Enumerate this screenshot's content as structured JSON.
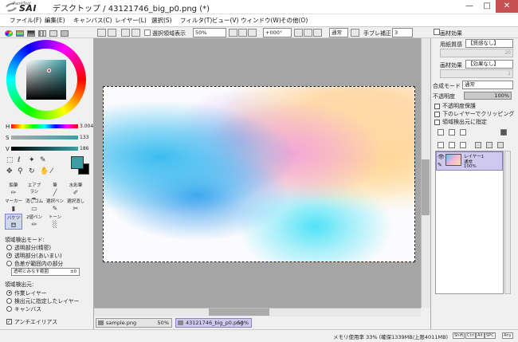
{
  "titlebar": {
    "logo_small": "PaintTool",
    "logo_big": "SAI",
    "window_title": "デスクトップ / 43121746_big_p0.png (*)",
    "min": "—",
    "max": "□",
    "close": "✕"
  },
  "menu": [
    "ファイル(F)",
    "編集(E)",
    "キャンバス(C)",
    "レイヤー(L)",
    "選択(S)",
    "フィルタ(T)",
    "ビュー(V)",
    "ウィンドウ(W)",
    "その他(O)"
  ],
  "toolbar": {
    "selection_label": "選択領域表示",
    "zoom": "50%",
    "rotation": "+000°",
    "blend": "通常",
    "stabilizer_label": "手ブレ補正",
    "stabilizer_value": "3"
  },
  "color": {
    "h_label": "H",
    "h_value": "3.004",
    "s_label": "S",
    "s_value": "133",
    "v_label": "V",
    "v_value": "186",
    "current": "#3aa0a6"
  },
  "brushes": [
    {
      "label": "鉛筆",
      "icon": "pencil-icon"
    },
    {
      "label": "エアブラシ",
      "icon": "airbrush-icon"
    },
    {
      "label": "筆",
      "icon": "brush-icon"
    },
    {
      "label": "水彩筆",
      "icon": "watercolor-icon"
    },
    {
      "label": "マーカー",
      "icon": "marker-icon"
    },
    {
      "label": "消しゴム",
      "icon": "eraser-icon"
    },
    {
      "label": "選択ペン",
      "icon": "select-pen-icon"
    },
    {
      "label": "選択消し",
      "icon": "select-erase-icon"
    },
    {
      "label": "バケツ",
      "icon": "bucket-icon"
    },
    {
      "label": "2値ペン",
      "icon": "binary-pen-icon"
    },
    {
      "label": "トーン",
      "icon": "tone-icon"
    }
  ],
  "detect": {
    "mode_title": "領域検出モード:",
    "mode_options": [
      "透明部分(精密)",
      "透明部分(あいまい)",
      "色差が範囲内の部分"
    ],
    "mode_selected": 1,
    "tolerance_label": "透明とみなす範囲",
    "tolerance_value": "±0",
    "source_title": "領域検出元:",
    "source_options": [
      "作業レイヤー",
      "検出元に指定したレイヤー",
      "キャンバス"
    ],
    "source_selected": 0,
    "antialias_label": "アンチエイリアス"
  },
  "doctabs": [
    {
      "name": "sample.png",
      "zoom": "50%"
    },
    {
      "name": "43121746_big_p0.png",
      "zoom": "50%"
    }
  ],
  "status": {
    "memory": "メモリ使用率 33% (確保1339MB/上限4011MB)",
    "keys": [
      "Shift",
      "Ctrl",
      "Alt",
      "SPC",
      "Any"
    ]
  },
  "right": {
    "effect_title": "画材効果",
    "paper_label": "用紙質感",
    "paper_value": "【質感なし】",
    "paper_num": "20",
    "effect_label": "画材効果",
    "effect_value": "【効果なし】",
    "effect_num": "1",
    "blend_label": "合成モード",
    "blend_value": "通常",
    "opacity_label": "不透明度",
    "opacity_value": "100%",
    "checks": [
      "不透明度保護",
      "下のレイヤーでクリッピング",
      "領域検出元に指定"
    ],
    "layer_name": "レイヤー1",
    "layer_mode": "通常",
    "layer_opacity": "100%"
  }
}
